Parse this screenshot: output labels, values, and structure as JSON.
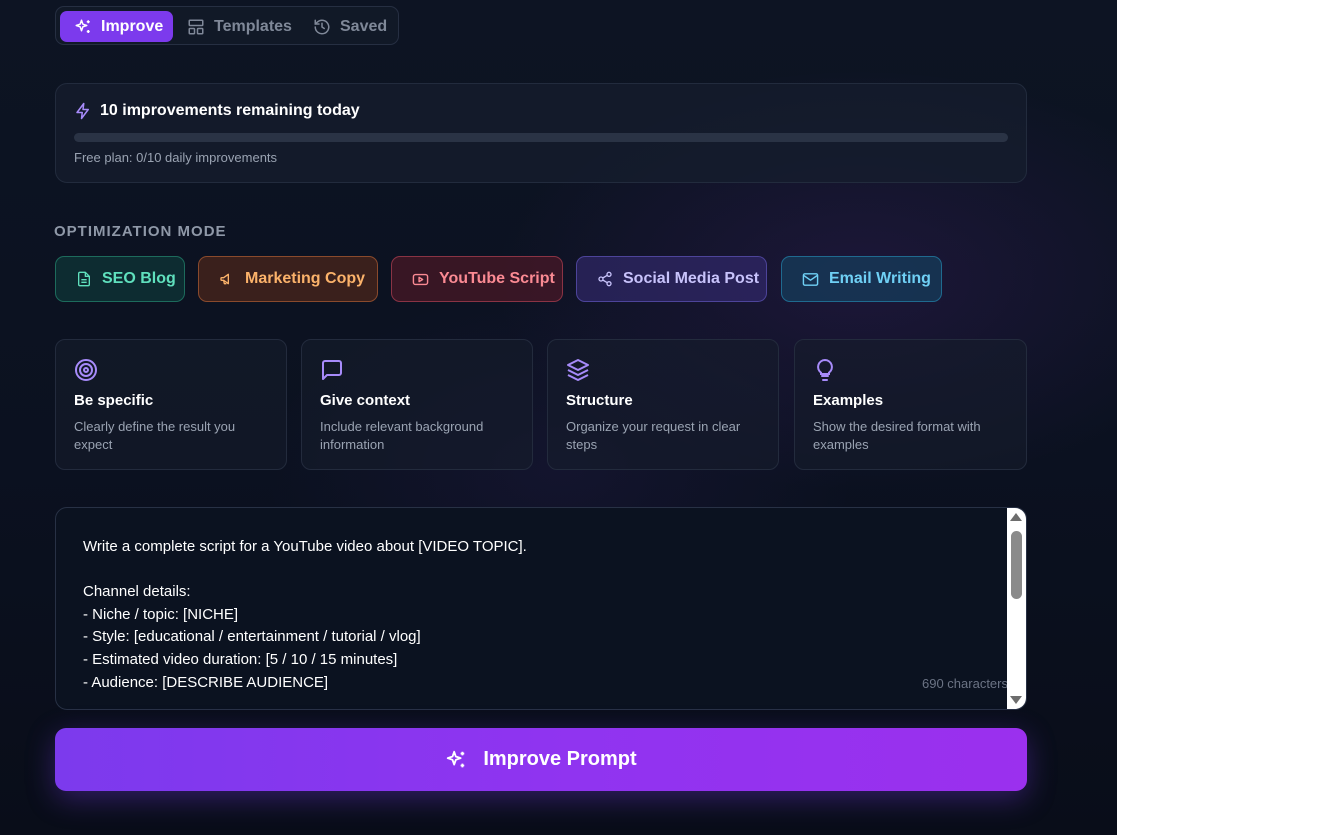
{
  "tabs": [
    {
      "label": "Improve",
      "icon": "sparkles-icon",
      "active": true
    },
    {
      "label": "Templates",
      "icon": "layout-icon",
      "active": false
    },
    {
      "label": "Saved",
      "icon": "history-icon",
      "active": false
    }
  ],
  "usage": {
    "title": "10 improvements remaining today",
    "subtitle": "Free plan: 0/10 daily improvements",
    "progress_fraction": 0,
    "icon": "zap-icon"
  },
  "optimization": {
    "label": "OPTIMIZATION MODE",
    "modes": [
      {
        "label": "SEO Blog",
        "icon": "file-text-icon",
        "color": "#5fe0bd"
      },
      {
        "label": "Marketing Copy",
        "icon": "megaphone-icon",
        "color": "#fbb26a"
      },
      {
        "label": "YouTube Script",
        "icon": "youtube-icon",
        "color": "#fb8a93"
      },
      {
        "label": "Social Media Post",
        "icon": "share-icon",
        "color": "#c8c3fb"
      },
      {
        "label": "Email Writing",
        "icon": "mail-icon",
        "color": "#6fd0f5"
      }
    ]
  },
  "tips": [
    {
      "title": "Be specific",
      "description": "Clearly define the result you expect",
      "icon": "target-icon"
    },
    {
      "title": "Give context",
      "description": "Include relevant background information",
      "icon": "message-square-icon"
    },
    {
      "title": "Structure",
      "description": "Organize your request in clear steps",
      "icon": "layers-icon"
    },
    {
      "title": "Examples",
      "description": "Show the desired format with examples",
      "icon": "lightbulb-icon"
    }
  ],
  "editor": {
    "text": "Write a complete script for a YouTube video about [VIDEO TOPIC].\n\nChannel details:\n- Niche / topic: [NICHE]\n- Style: [educational / entertainment / tutorial / vlog]\n- Estimated video duration: [5 / 10 / 15 minutes]\n- Audience: [DESCRIBE AUDIENCE]",
    "char_count": "690 characters"
  },
  "submit": {
    "label": "Improve Prompt",
    "icon": "sparkles-icon"
  },
  "colors": {
    "accent": "#7c3aed",
    "background": "#0b1120"
  }
}
